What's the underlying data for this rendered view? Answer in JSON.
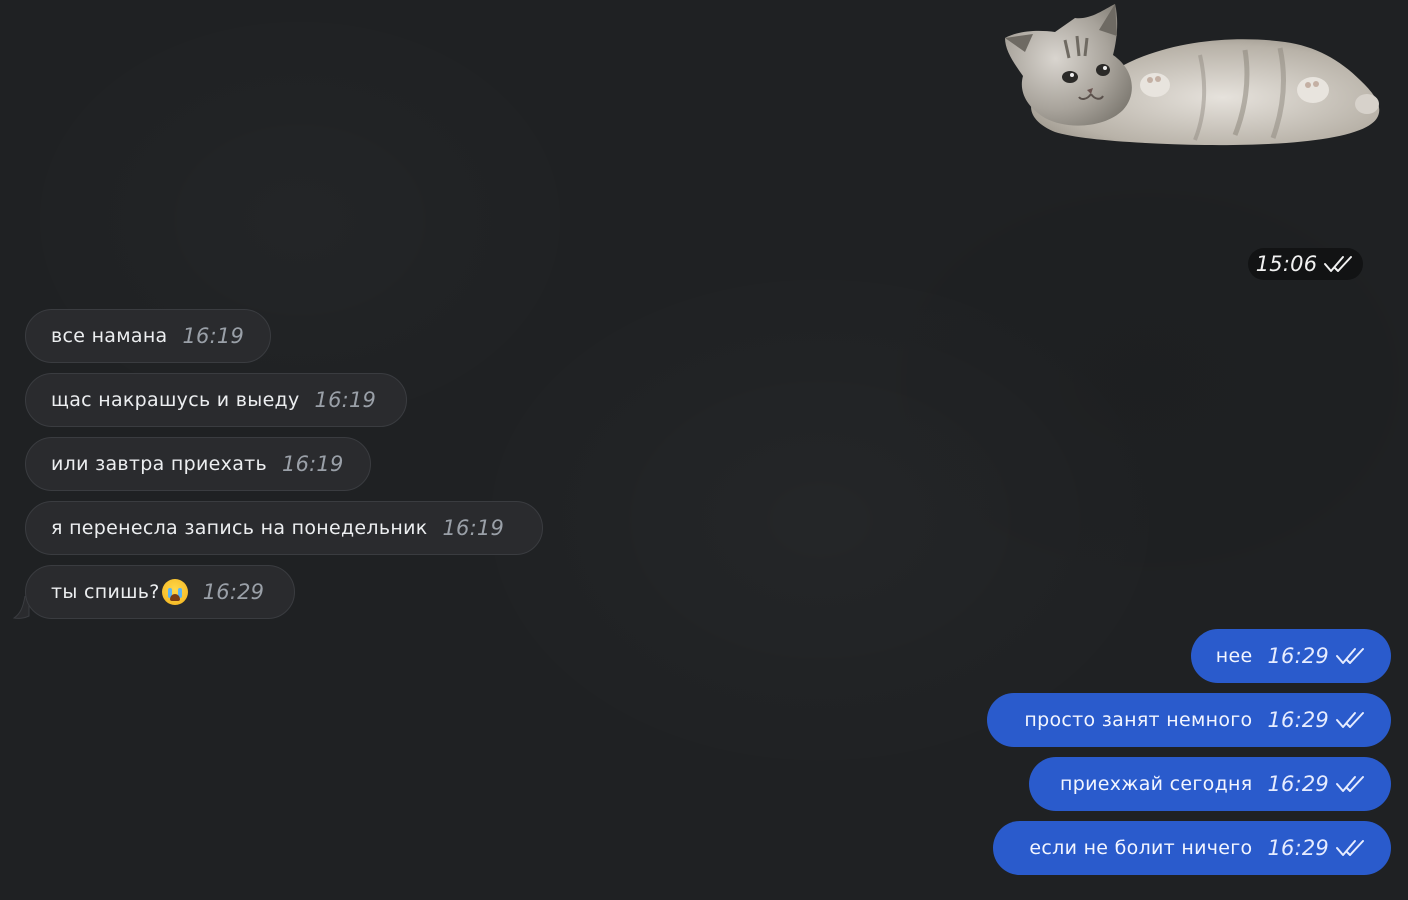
{
  "sticker": {
    "icon": "kitten-sticker",
    "time": "15:06"
  },
  "messages": [
    {
      "side": "in",
      "text": "все намана",
      "time": "16:19"
    },
    {
      "side": "in",
      "text": "щас накрашусь и выеду",
      "time": "16:19"
    },
    {
      "side": "in",
      "text": "или завтра приехать",
      "time": "16:19"
    },
    {
      "side": "in",
      "text": "я перенесла запись на понедельник",
      "time": "16:19"
    },
    {
      "side": "in",
      "text": "ты спишь?",
      "emoji": "crying-face-icon",
      "time": "16:29"
    },
    {
      "side": "out",
      "text": "нее",
      "time": "16:29"
    },
    {
      "side": "out",
      "text": "просто занят немного",
      "time": "16:29"
    },
    {
      "side": "out",
      "text": "приехжай сегодня",
      "time": "16:29"
    },
    {
      "side": "out",
      "text": "если не болит ничего",
      "time": "16:29"
    }
  ],
  "colors": {
    "background": "#1f2123",
    "incoming": "#2a2b2e",
    "outgoing": "#2a5bcc"
  }
}
